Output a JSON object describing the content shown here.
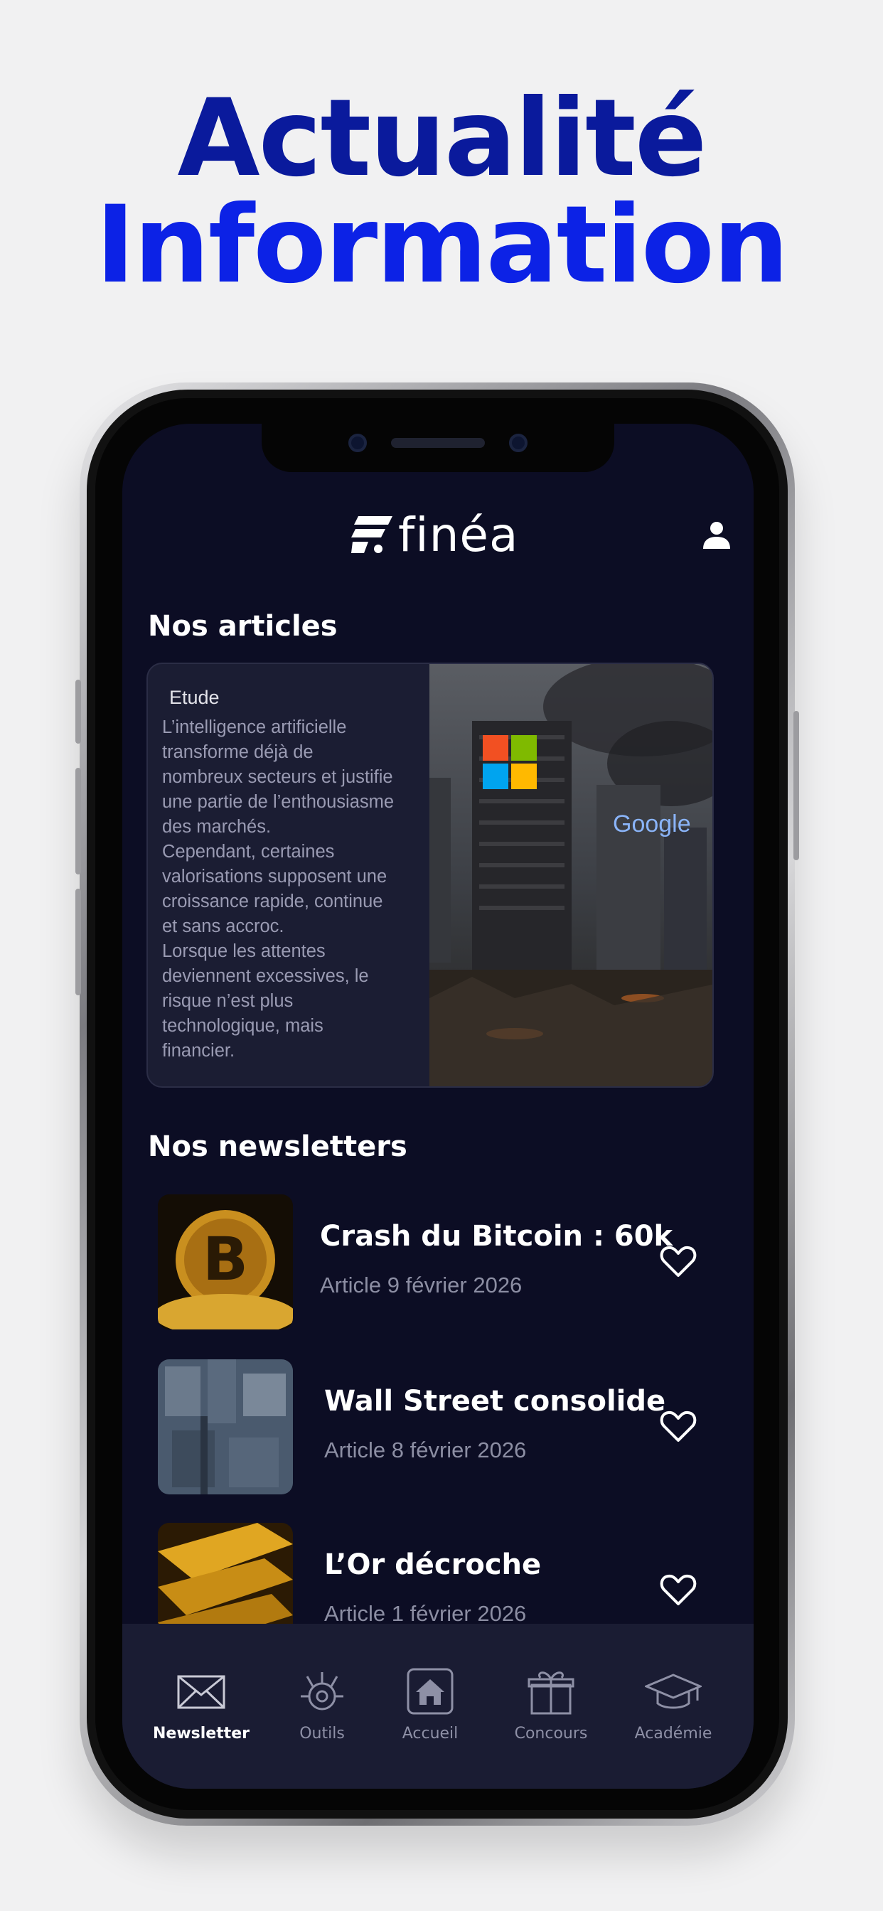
{
  "headline": {
    "line1": "Actualité",
    "line2": "Information"
  },
  "app": {
    "logo_text": "finéa",
    "articles_section": {
      "title": "Nos articles",
      "card": {
        "tag": "Etude",
        "body": "L’intelligence artificielle\ntransforme déjà de\nnombreux secteurs et justifie\nune partie de l’enthousiasme\ndes marchés.\nCependant, certaines\nvalorisations supposent une\ncroissance rapide, continue\net sans accroc.\nLorsque les attentes\ndeviennent excessives, le\nrisque n’est plus\ntechnologique, mais\nfinancier.",
        "image_text": "Google"
      }
    },
    "newsletters_section": {
      "title": "Nos newsletters",
      "items": [
        {
          "title": "Crash du Bitcoin : 60k",
          "meta": "Article 9 février 2026",
          "thumb": "bitcoin-coin"
        },
        {
          "title": "Wall Street consolide",
          "meta": "Article 8 février 2026",
          "thumb": "city-aerial"
        },
        {
          "title": "L’Or décroche",
          "meta": "Article 1 février 2026",
          "thumb": "gold-bars"
        }
      ]
    },
    "tabbar": {
      "items": [
        {
          "label": "Newsletter",
          "icon": "envelope-icon",
          "active": true
        },
        {
          "label": "Outils",
          "icon": "tools-icon",
          "active": false
        },
        {
          "label": "Accueil",
          "icon": "home-icon",
          "active": false
        },
        {
          "label": "Concours",
          "icon": "gift-icon",
          "active": false
        },
        {
          "label": "Académie",
          "icon": "graduation-cap-icon",
          "active": false
        }
      ]
    }
  },
  "colors": {
    "headline_dark": "#0a1a9c",
    "headline_bright": "#0c22e6",
    "screen_bg": "#0c0d24",
    "card_bg": "#1b1d33",
    "tabbar_bg": "#1a1c33"
  }
}
